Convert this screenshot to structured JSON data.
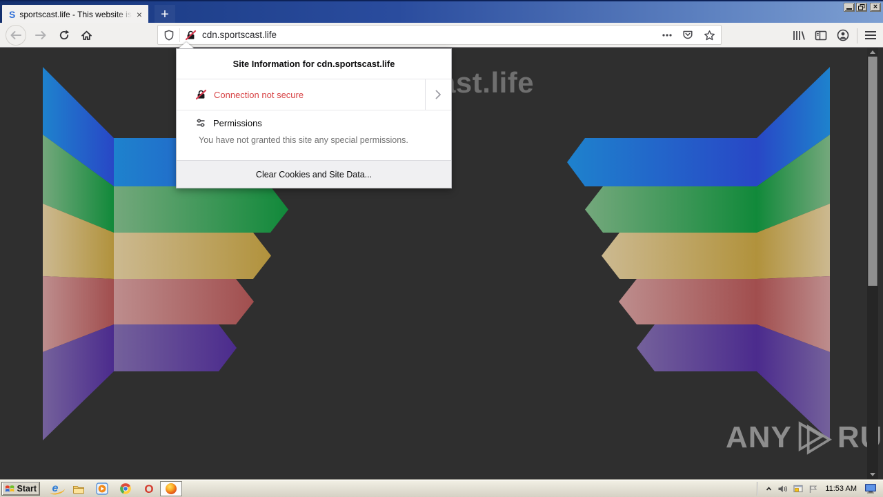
{
  "tab": {
    "title": "sportscast.life - This website is fo",
    "favicon": "S"
  },
  "navbar": {
    "url": "cdn.sportscast.life"
  },
  "popup": {
    "title": "Site Information for cdn.sportscast.life",
    "connection_label": "Connection not secure",
    "permissions_label": "Permissions",
    "permissions_note": "You have not granted this site any special permissions.",
    "clear_button": "Clear Cookies and Site Data..."
  },
  "page": {
    "heading": "sportscast.life",
    "background": "#2f2f2f",
    "heading_color": "#6f6f6f",
    "watermark": {
      "left": "ANY",
      "right": "RUN"
    },
    "ribbons": [
      {
        "name": "blue",
        "light": "#1e82cd",
        "dark": "#2847c6"
      },
      {
        "name": "green",
        "light": "#74a87c",
        "dark": "#11893a"
      },
      {
        "name": "yellow",
        "light": "#ccb990",
        "dark": "#b1923c"
      },
      {
        "name": "red",
        "light": "#bd8d8d",
        "dark": "#a14e4e"
      },
      {
        "name": "purple",
        "light": "#74619b",
        "dark": "#4b2b8d"
      }
    ]
  },
  "taskbar": {
    "start_label": "Start",
    "clock": "11:53 AM",
    "quick_launch": [
      "internet-explorer",
      "windows-explorer",
      "media-player",
      "chrome",
      "opera",
      "firefox"
    ],
    "tray": [
      "hide-icons",
      "volume",
      "windows-update",
      "network-flag",
      "clock",
      "display"
    ]
  },
  "icons": {
    "tab_close": "×",
    "new_tab": "+",
    "win_close": "×",
    "opera": "O",
    "internet_explorer": "e"
  }
}
